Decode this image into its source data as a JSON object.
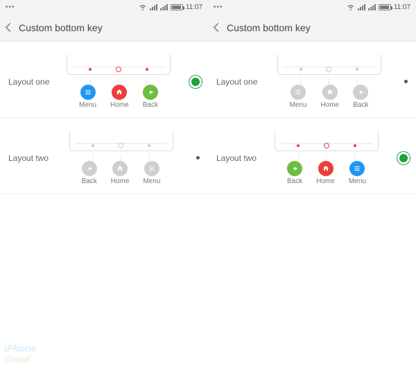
{
  "status": {
    "time": "11:07"
  },
  "header": {
    "title": "Custom bottom key"
  },
  "screens": [
    {
      "selected": "layout_one",
      "options": [
        {
          "id": "layout_one",
          "label": "Layout one",
          "active_colors": true,
          "keys": [
            {
              "name": "Menu",
              "icon": "menu",
              "color": "blue"
            },
            {
              "name": "Home",
              "icon": "home",
              "color": "red"
            },
            {
              "name": "Back",
              "icon": "back",
              "color": "green"
            }
          ]
        },
        {
          "id": "layout_two",
          "label": "Layout two",
          "active_colors": false,
          "keys": [
            {
              "name": "Back",
              "icon": "back",
              "color": "grey"
            },
            {
              "name": "Home",
              "icon": "home",
              "color": "grey"
            },
            {
              "name": "Menu",
              "icon": "menu",
              "color": "grey"
            }
          ]
        }
      ]
    },
    {
      "selected": "layout_two",
      "options": [
        {
          "id": "layout_one",
          "label": "Layout one",
          "active_colors": false,
          "keys": [
            {
              "name": "Menu",
              "icon": "menu",
              "color": "grey"
            },
            {
              "name": "Home",
              "icon": "home",
              "color": "grey"
            },
            {
              "name": "Back",
              "icon": "back",
              "color": "grey"
            }
          ]
        },
        {
          "id": "layout_two",
          "label": "Layout two",
          "active_colors": true,
          "keys": [
            {
              "name": "Back",
              "icon": "back",
              "color": "green"
            },
            {
              "name": "Home",
              "icon": "home",
              "color": "red"
            },
            {
              "name": "Menu",
              "icon": "menu",
              "color": "blue"
            }
          ]
        }
      ]
    }
  ],
  "watermark": {
    "line1": "iPhone",
    "line2": "Droid"
  }
}
